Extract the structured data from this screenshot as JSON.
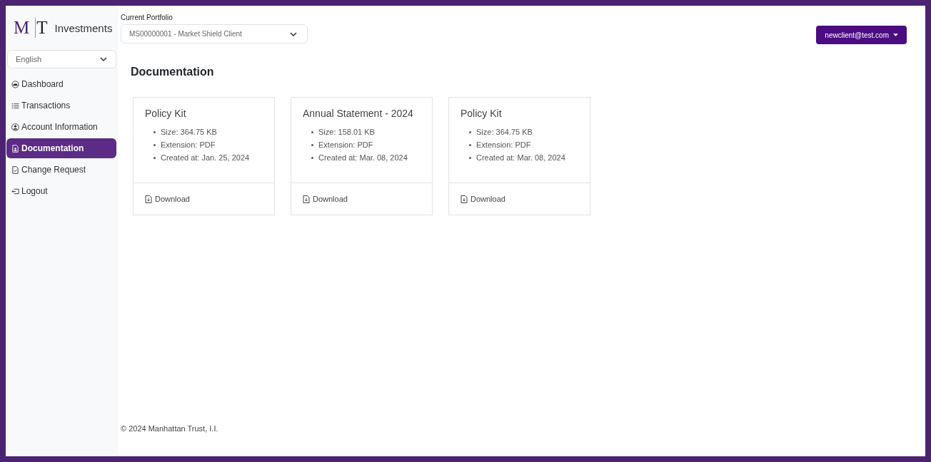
{
  "logo": {
    "first_letter": "M",
    "second_letter": "T",
    "name": "Investments"
  },
  "language_select": {
    "value": "English"
  },
  "nav": [
    {
      "label": "Dashboard",
      "selected": false
    },
    {
      "label": "Transactions",
      "selected": false
    },
    {
      "label": "Account Information",
      "selected": false
    },
    {
      "label": "Documentation",
      "selected": true
    },
    {
      "label": "Change Request",
      "selected": false
    },
    {
      "label": "Logout",
      "selected": false
    }
  ],
  "portfolio": {
    "label": "Current Portfolio",
    "value": "MS00000001 - Market Shield Client"
  },
  "user_menu": {
    "label": "newclient@test.com"
  },
  "page_title": "Documentation",
  "documents": [
    {
      "title": "Policy Kit",
      "details": [
        "Size: 364.75 KB",
        "Extension: PDF",
        "Created at: Jan. 25, 2024"
      ],
      "action": "Download"
    },
    {
      "title": "Annual Statement - 2024",
      "details": [
        "Size: 158.01 KB",
        "Extension: PDF",
        "Created at: Mar. 08, 2024"
      ],
      "action": "Download"
    },
    {
      "title": "Policy Kit",
      "details": [
        "Size: 364.75 KB",
        "Extension: PDF",
        "Created at: Mar. 08, 2024"
      ],
      "action": "Download"
    }
  ],
  "footer": "© 2024 Manhattan Trust, I.I."
}
